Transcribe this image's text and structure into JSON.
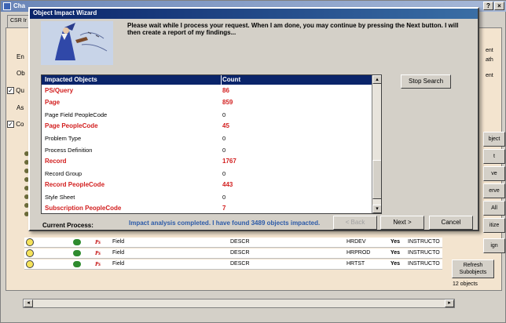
{
  "background_window": {
    "title": "Cha",
    "tab": "CSR Ir",
    "labels": [
      "En",
      "Ob",
      "Qu",
      "As",
      "Co"
    ],
    "side_labels": [
      "ent",
      "ath",
      "ent"
    ],
    "side_buttons": [
      "bject",
      "t",
      "ve",
      "erve",
      "All",
      "itize",
      "ign"
    ],
    "refresh_button": "Refresh Subobjects",
    "object_count": "12 objects",
    "grid_rows": [
      {
        "type": "Field",
        "name": "DESCR",
        "db": "HRDEV",
        "flag": "Yes",
        "owner": "INSTRUCTO"
      },
      {
        "type": "Field",
        "name": "DESCR",
        "db": "HRPROD",
        "flag": "Yes",
        "owner": "INSTRUCTO"
      },
      {
        "type": "Field",
        "name": "DESCR",
        "db": "HRTST",
        "flag": "Yes",
        "owner": "INSTRUCTO"
      }
    ],
    "ps_glyph": "Ps"
  },
  "wizard": {
    "title": "Object Impact Wizard",
    "message": "Please wait while I process your request.  When I am done, you may continue by pressing the Next button.  I will then create a report of my findings...",
    "list": {
      "columns": [
        "Impacted Objects",
        "Count"
      ],
      "rows": [
        {
          "name": "PS/Query",
          "count": "86",
          "highlight": true
        },
        {
          "name": "Page",
          "count": "859",
          "highlight": true
        },
        {
          "name": "Page Field PeopleCode",
          "count": "0",
          "highlight": false
        },
        {
          "name": "Page PeopleCode",
          "count": "45",
          "highlight": true
        },
        {
          "name": "Problem Type",
          "count": "0",
          "highlight": false
        },
        {
          "name": "Process Definition",
          "count": "0",
          "highlight": false
        },
        {
          "name": "Record",
          "count": "1767",
          "highlight": true
        },
        {
          "name": "Record Group",
          "count": "0",
          "highlight": false
        },
        {
          "name": "Record PeopleCode",
          "count": "443",
          "highlight": true
        },
        {
          "name": "Style Sheet",
          "count": "0",
          "highlight": false
        },
        {
          "name": "Subscription PeopleCode",
          "count": "7",
          "highlight": true
        }
      ]
    },
    "stop_search_label": "Stop Search",
    "current_process_label": "Current Process:",
    "current_process_value": "Impact analysis completed.  I have found 3489 objects impacted.",
    "back_label": "< Back",
    "next_label": "Next >",
    "cancel_label": "Cancel"
  },
  "colors": {
    "title_bar": "#0a246a",
    "highlight_text": "#d21e1e",
    "status_text": "#2c5aa8"
  }
}
